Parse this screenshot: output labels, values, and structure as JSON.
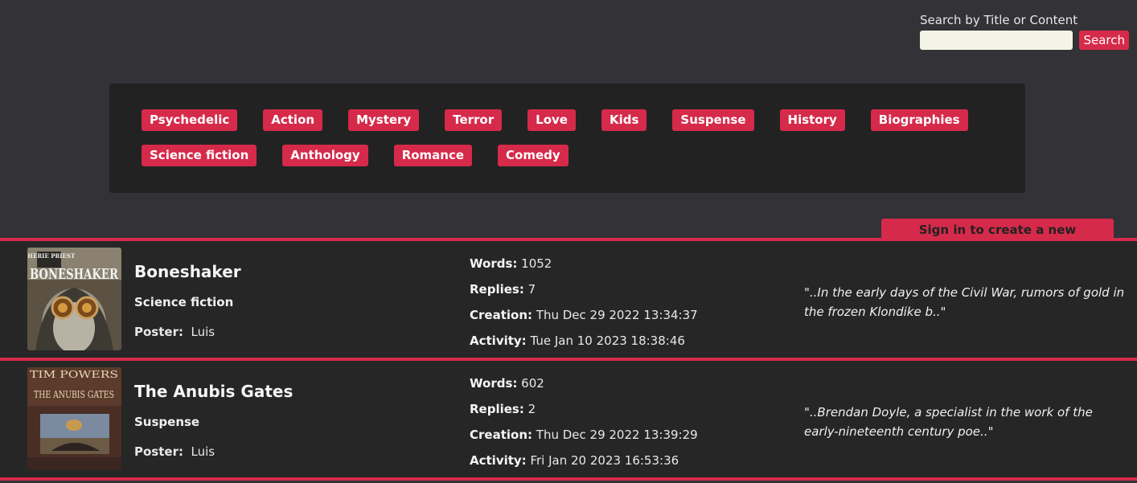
{
  "search": {
    "label": "Search by Title or Content",
    "placeholder": "",
    "button_label": "Search"
  },
  "genres": {
    "row1": [
      "Psychedelic",
      "Action",
      "Mystery",
      "Terror",
      "Love",
      "Kids",
      "Suspense",
      "History",
      "Biographies"
    ],
    "row2": [
      "Science fiction",
      "Anthology",
      "Romance",
      "Comedy"
    ]
  },
  "sign_in_label": "Sign in to create a new discussion...",
  "colors": {
    "accent": "#d62a4a",
    "background": "#333236",
    "panel": "#222222",
    "row": "#262626"
  },
  "labels": {
    "poster": "Poster:",
    "words": "Words:",
    "replies": "Replies:",
    "creation": "Creation:",
    "activity": "Activity:"
  },
  "discussions": [
    {
      "title": "Boneshaker",
      "genre": "Science fiction",
      "poster": "Luis",
      "words": "1052",
      "replies": "7",
      "creation": "Thu Dec 29 2022 13:34:37",
      "activity": "Tue Jan 10 2023 18:38:46",
      "excerpt": "\"..In the early days of the Civil War, rumors of gold in the frozen Klondike b..\"",
      "cover_author": "CHERIE PRIEST",
      "cover_title": "BONESHAKER"
    },
    {
      "title": "The Anubis Gates",
      "genre": "Suspense",
      "poster": "Luis",
      "words": "602",
      "replies": "2",
      "creation": "Thu Dec 29 2022 13:39:29",
      "activity": "Fri Jan 20 2023 16:53:36",
      "excerpt": "\"..Brendan Doyle, a specialist in the work of the early-nineteenth century poe..\"",
      "cover_author": "TIM POWERS",
      "cover_title": "THE ANUBIS GATES"
    }
  ]
}
